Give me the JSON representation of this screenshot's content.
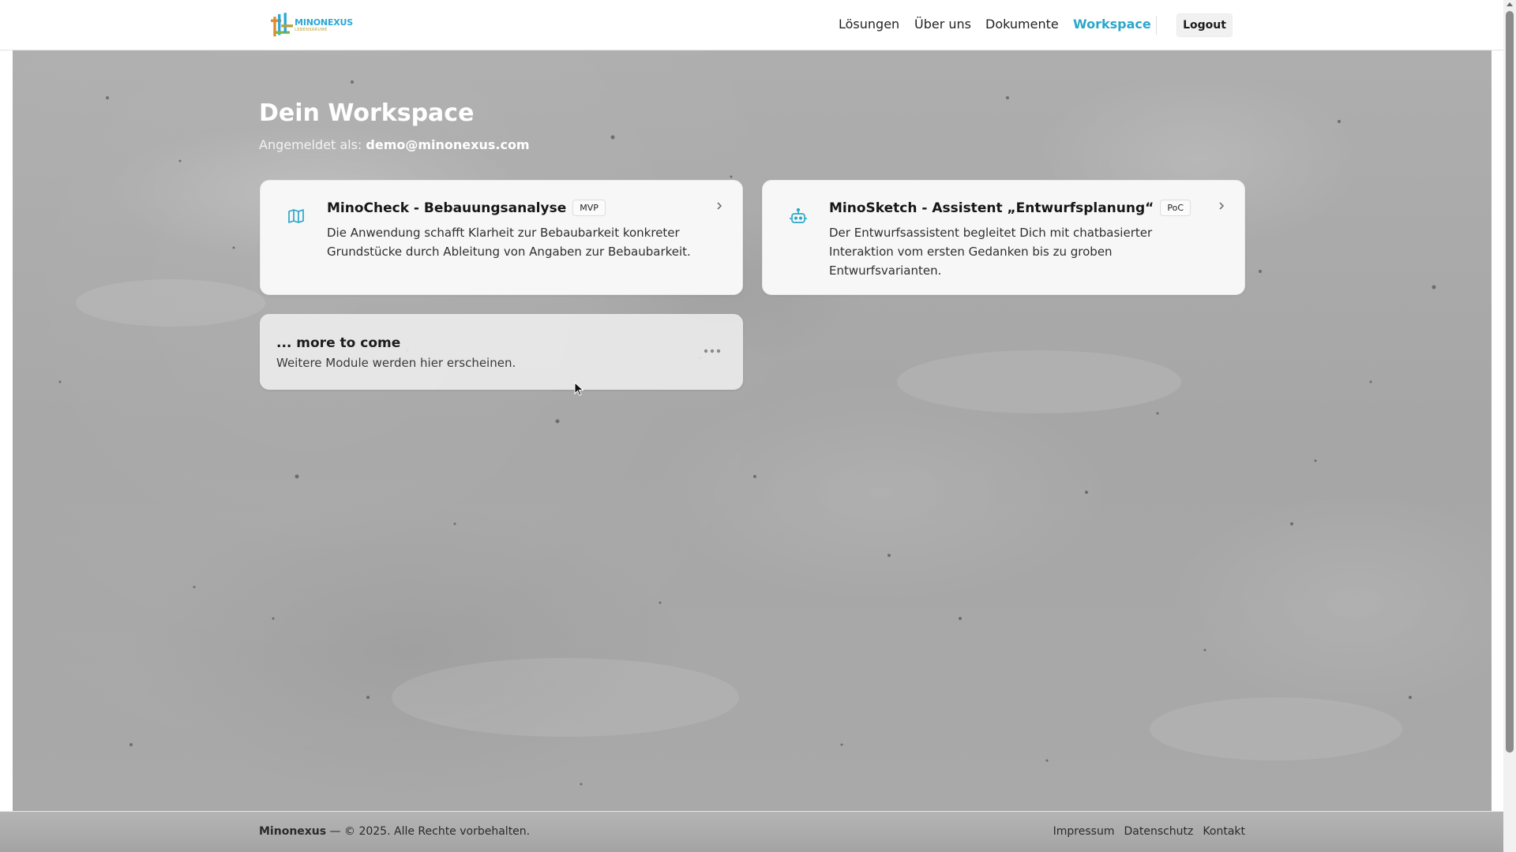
{
  "header": {
    "logo": {
      "name": "MINONEXUS",
      "sub": "LEBENSRÄUME"
    },
    "nav": [
      {
        "label": "Lösungen",
        "active": false
      },
      {
        "label": "Über uns",
        "active": false
      },
      {
        "label": "Dokumente",
        "active": false
      },
      {
        "label": "Workspace",
        "active": true
      }
    ],
    "logout_label": "Logout"
  },
  "main": {
    "title": "Dein Workspace",
    "subtitle_prefix": "Angemeldet als:",
    "user_email": "demo@minonexus.com",
    "modules": [
      {
        "icon": "map-icon",
        "title": "MinoCheck - Bebauungsanalyse",
        "badge": "MVP",
        "description": "Die Anwendung schafft Klarheit zur Bebaubarkeit konkreter Grundstücke durch Ableitung von Angaben zur Bebaubarkeit."
      },
      {
        "icon": "robot-icon",
        "title": "MinoSketch - Assistent „Entwurfsplanung“",
        "badge": "PoC",
        "description": "Der Entwurfsassistent begleitet Dich mit chatbasierter Interaktion vom ersten Gedanken bis zu groben Entwurfsvarianten."
      }
    ],
    "more": {
      "title": "... more to come",
      "description": "Weitere Module werden hier erscheinen.",
      "icon": "more-dots-icon"
    }
  },
  "footer": {
    "brand": "Minonexus",
    "copyright": " — © 2025. Alle Rechte vorbehalten.",
    "links": [
      "Impressum",
      "Datenschutz",
      "Kontakt"
    ]
  },
  "colors": {
    "accent": "#2aa7c9",
    "card_bg": "#f7f7f7",
    "concrete": "#a9a9a9"
  }
}
